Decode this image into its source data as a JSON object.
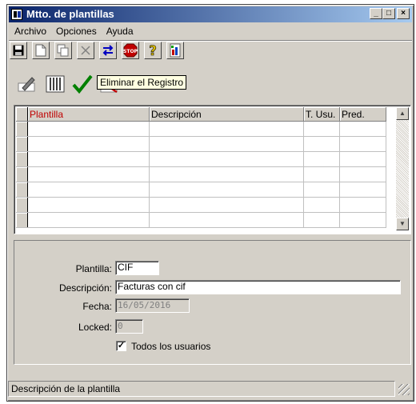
{
  "window": {
    "title": "Mtto. de plantillas",
    "minimize": "_",
    "maximize": "□",
    "close": "×"
  },
  "menu": [
    {
      "label": "Archivo"
    },
    {
      "label": "Opciones"
    },
    {
      "label": "Ayuda"
    }
  ],
  "toolbar": {
    "tooltip": "Eliminar el Registro",
    "icons": [
      "save-icon",
      "new-icon",
      "copy-icon",
      "delete-icon",
      "swap-icon",
      "stop-icon",
      "help-icon",
      "report-icon"
    ],
    "icons2": [
      "edit-pencil-icon",
      "grid-columns-icon",
      "checkmark-icon",
      "cancel-icon"
    ]
  },
  "grid": {
    "columns": [
      {
        "label": "Plantilla",
        "highlight": true
      },
      {
        "label": "Descripción",
        "highlight": false
      },
      {
        "label": "T. Usu.",
        "highlight": false
      },
      {
        "label": "Pred.",
        "highlight": false
      }
    ],
    "rows": [
      [
        "",
        "",
        "",
        ""
      ],
      [
        "",
        "",
        "",
        ""
      ],
      [
        "",
        "",
        "",
        ""
      ],
      [
        "",
        "",
        "",
        ""
      ],
      [
        "",
        "",
        "",
        ""
      ],
      [
        "",
        "",
        "",
        ""
      ],
      [
        "",
        "",
        "",
        ""
      ]
    ]
  },
  "form": {
    "plantilla": {
      "label": "Plantilla:",
      "value": "CIF"
    },
    "descripcion": {
      "label": "Descripción:",
      "value": "Facturas con cif"
    },
    "fecha": {
      "label": "Fecha:",
      "value": "16/05/2016"
    },
    "locked": {
      "label": "Locked:",
      "value": "0"
    },
    "todos": {
      "label": "Todos los usuarios",
      "checked": true,
      "mark": "✓"
    }
  },
  "status": {
    "text": "Descripción de la plantilla"
  },
  "colors": {
    "title_start": "#0a246a",
    "title_end": "#a6caf0",
    "face": "#d4d0c8",
    "header_highlight": "#c00000",
    "tooltip_bg": "#ffffe1"
  }
}
